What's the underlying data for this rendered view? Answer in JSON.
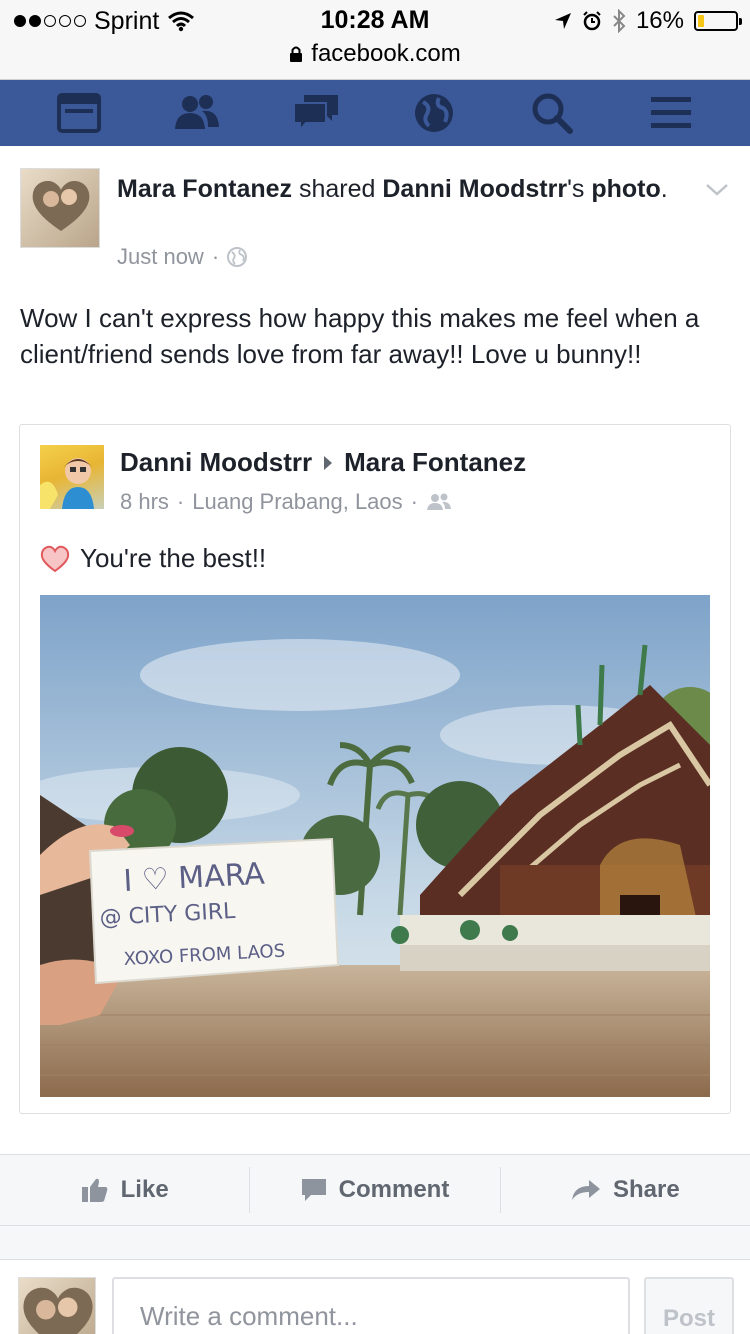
{
  "status_bar": {
    "carrier": "Sprint",
    "time": "10:28 AM",
    "battery": "16%",
    "battery_level": 0.16,
    "url": "facebook.com"
  },
  "nav": {
    "icons": [
      "news-feed-icon",
      "friend-requests-icon",
      "messages-icon",
      "notifications-globe-icon",
      "search-icon",
      "menu-icon"
    ],
    "color": "#3b5998"
  },
  "post": {
    "author": "Mara Fontanez",
    "shared_text": " shared ",
    "original_author": "Danni Moodstrr",
    "possessive": "'s",
    "object": "photo",
    "period": ".",
    "time": "Just now",
    "body": "Wow I can't express how happy this makes me feel when a client/friend sends love from far away!! Love u bunny!!",
    "shared": {
      "from": "Danni Moodstrr",
      "to": "Mara Fontanez",
      "time": "8 hrs",
      "location": "Luang Prabang, Laos",
      "text": "You're the best!!",
      "photo_note": {
        "line1": "I ♡ MARA",
        "line2": "@ CITY GIRL",
        "line3": "XOXO FROM LAOS"
      }
    }
  },
  "actions": {
    "like": "Like",
    "comment": "Comment",
    "share": "Share"
  },
  "composer": {
    "placeholder": "Write a comment...",
    "post_button": "Post"
  }
}
